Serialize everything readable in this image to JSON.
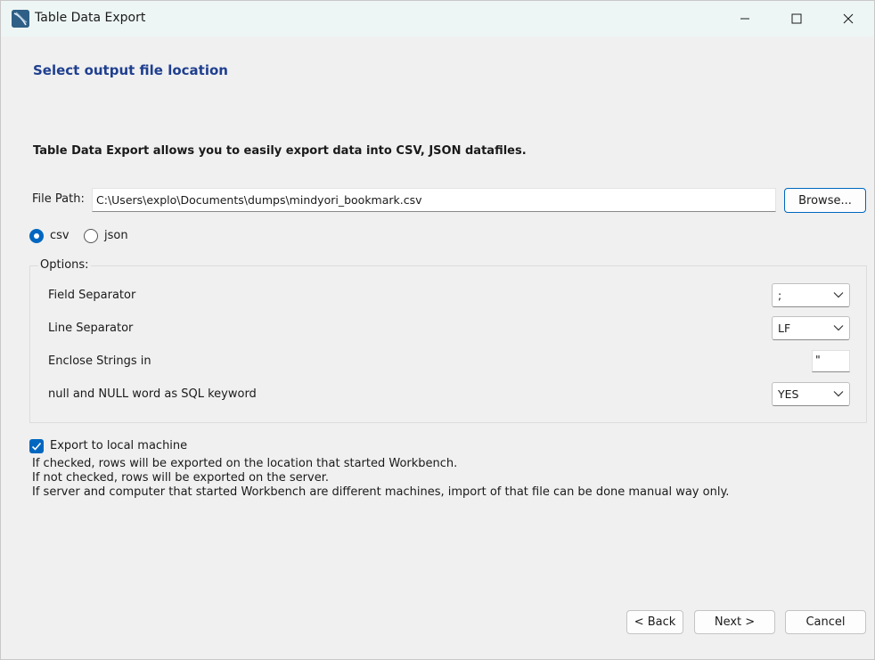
{
  "window": {
    "title": "Table Data Export"
  },
  "page": {
    "heading": "Select output file location",
    "description": "Table Data Export allows you to easily export data into CSV, JSON datafiles."
  },
  "file_path": {
    "label": "File Path:",
    "value": "C:\\Users\\explo\\Documents\\dumps\\mindyori_bookmark.csv",
    "browse_label": "Browse..."
  },
  "format": {
    "options": [
      "csv",
      "json"
    ],
    "selected": "csv"
  },
  "options": {
    "legend": "Options:",
    "field_separator": {
      "label": "Field Separator",
      "value": ";"
    },
    "line_separator": {
      "label": "Line Separator",
      "value": "LF"
    },
    "enclose_strings": {
      "label": "Enclose Strings in",
      "value": "\""
    },
    "null_keyword": {
      "label": "null and NULL word as SQL keyword",
      "value": "YES"
    }
  },
  "export_local": {
    "label": "Export to local machine",
    "checked": true,
    "info": [
      "If checked, rows will be exported on the location that started Workbench.",
      "If not checked, rows will be exported on the server.",
      "If server and computer that started Workbench are different machines, import of that file can be done manual way only."
    ]
  },
  "navigation": {
    "back_label": "< Back",
    "next_label": "Next >",
    "cancel_label": "Cancel"
  },
  "colors": {
    "accent": "#0067c0",
    "heading": "#1f3f8f",
    "titlebar": "#eef6f5"
  }
}
